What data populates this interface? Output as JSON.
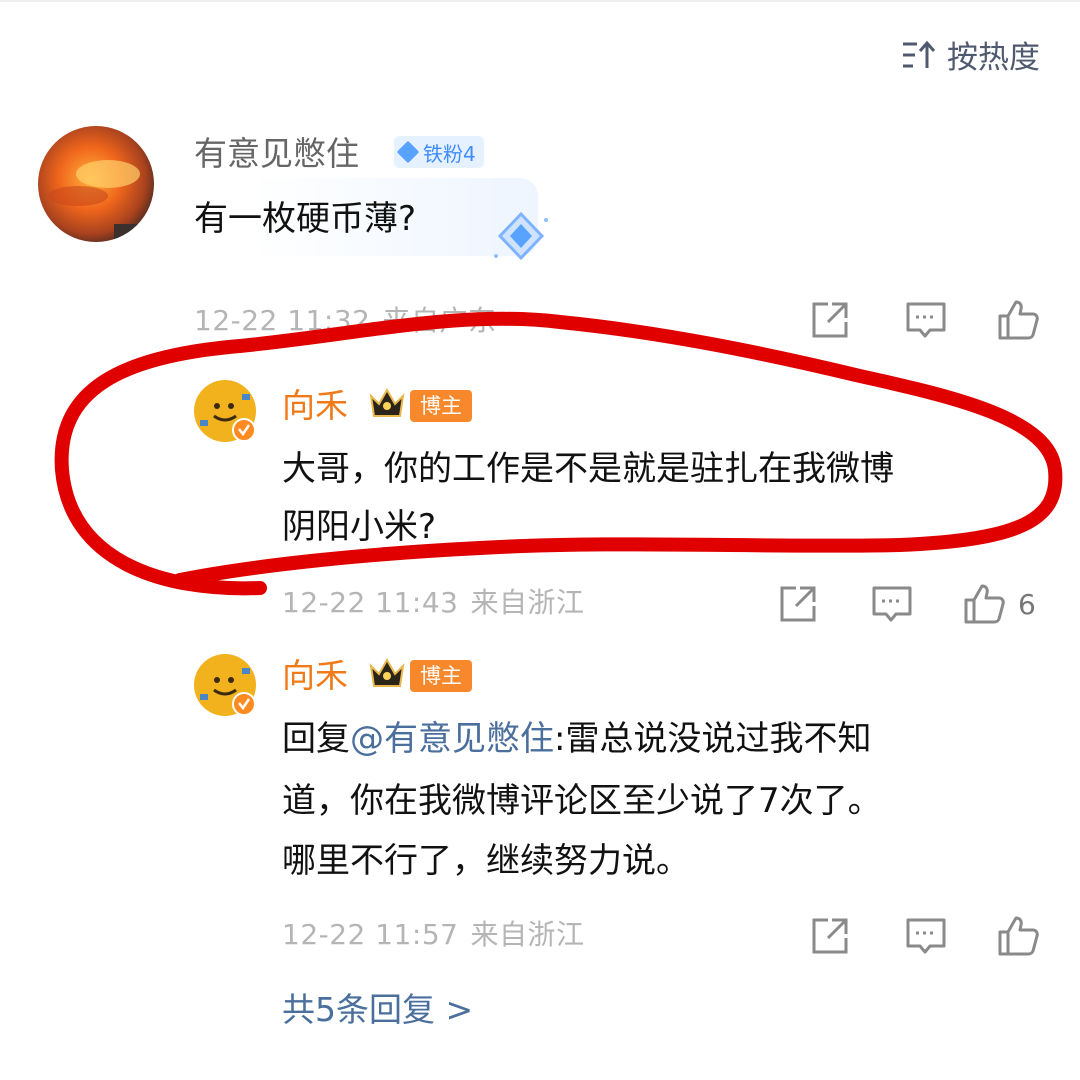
{
  "sort": {
    "label": "按热度"
  },
  "comment": {
    "username": "有意见憋住",
    "fan_badge": "铁粉4",
    "text": "有一枚硬币薄?",
    "time": "12-22 11:32",
    "location": "来自广东"
  },
  "replies": [
    {
      "username": "向禾",
      "badge": "博主",
      "text_line1": "大哥，你的工作是不是就是驻扎在我微博",
      "text_line2": "阴阳小米?",
      "time": "12-22 11:43",
      "location": "来自浙江",
      "likes": "6"
    },
    {
      "username": "向禾",
      "badge": "博主",
      "reply_prefix": "回复",
      "mention": "@有意见憋住",
      "text_line1": ":雷总说没说过我不知",
      "text_line2": "道，你在我微博评论区至少说了7次了。",
      "text_line3": "哪里不行了，继续努力说。",
      "time": "12-22 11:57",
      "location": "来自浙江"
    }
  ],
  "more_replies": "共5条回复 >",
  "colors": {
    "owner_name": "#f07a17",
    "owner_badge": "#f7882c",
    "link": "#4a6f9d",
    "annotation_red": "#e00000"
  },
  "icons": [
    "sort-icon",
    "share-icon",
    "comment-icon",
    "like-icon",
    "crown-icon",
    "verified-icon",
    "diamond-icon"
  ]
}
